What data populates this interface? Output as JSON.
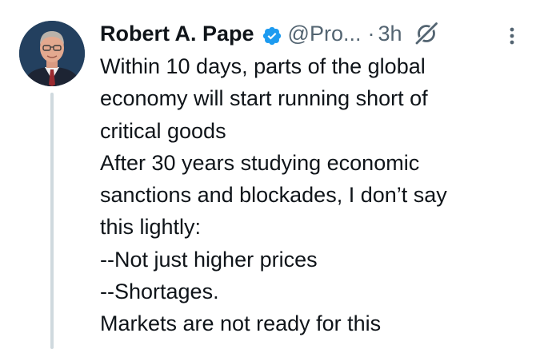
{
  "tweet": {
    "author_name": "Robert A. Pape",
    "handle": "@Pro...",
    "separator": "·",
    "time": "3h",
    "verified_color": "#1d9bf0",
    "lines": [
      "Within 10 days, parts of the global",
      "economy will start running short of",
      "critical goods",
      "After 30 years studying economic",
      "sanctions and blockades, I don’t say",
      "this lightly:",
      "--Not just higher prices",
      "--Shortages.",
      "Markets are not ready for this"
    ]
  },
  "icons": {
    "verified": "verified-badge-icon",
    "grok": "grok-icon",
    "more": "more-options-icon",
    "avatar": "avatar"
  }
}
